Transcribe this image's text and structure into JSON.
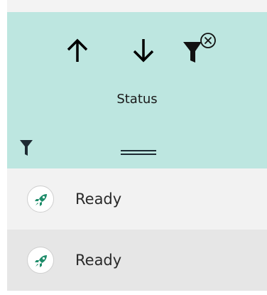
{
  "column": {
    "title": "Status",
    "header_bg": "#bde6e0",
    "icons": {
      "sort_ascending": "arrow-up-icon",
      "sort_descending": "arrow-down-icon",
      "clear_filter": "filter-clear-icon",
      "filter": "filter-icon",
      "resize": "double-line-icon"
    }
  },
  "rows": [
    {
      "label": "Ready",
      "icon": "rocket-icon",
      "bg": "#f2f2f2"
    },
    {
      "label": "Ready",
      "icon": "rocket-icon",
      "bg": "#e6e6e6"
    }
  ]
}
